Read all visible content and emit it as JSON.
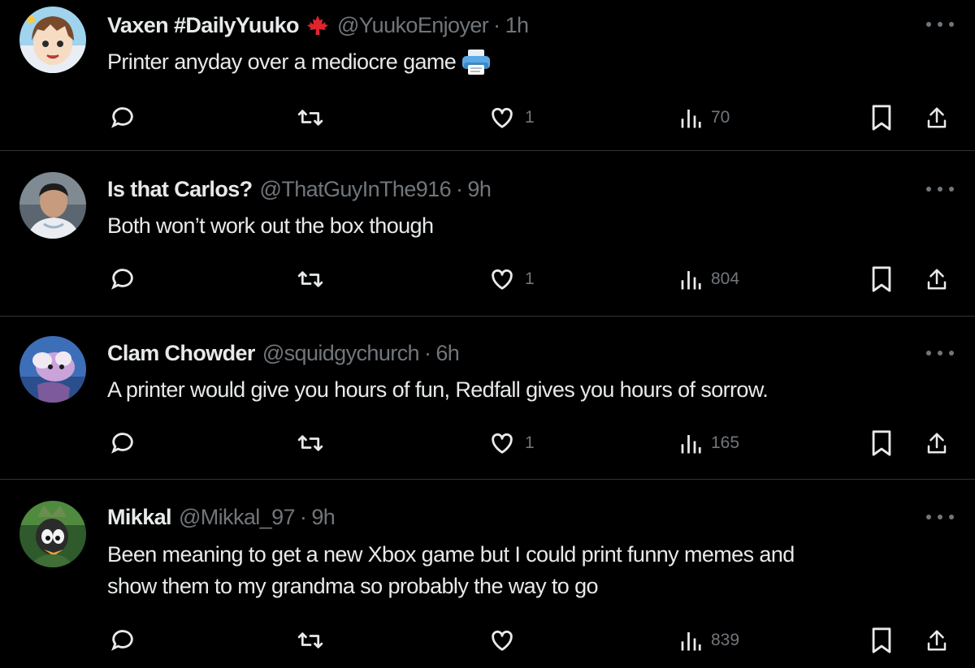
{
  "colors": {
    "background": "#000000",
    "primary_text": "#e7e9ea",
    "secondary_text": "#71767b",
    "divider": "#2f3336"
  },
  "tweets": [
    {
      "display_name": "Vaxen #DailyYuuko",
      "badge_icon": "canada-maple-leaf-icon",
      "handle": "@YuukoEnjoyer",
      "separator": "·",
      "time": "1h",
      "text": "Printer anyday over a mediocre game",
      "text_emoji": "printer-emoji",
      "likes": "1",
      "views": "70"
    },
    {
      "display_name": "Is that Carlos?",
      "handle": "@ThatGuyInThe916",
      "separator": "·",
      "time": "9h",
      "text": "Both won’t work out the box though",
      "likes": "1",
      "views": "804"
    },
    {
      "display_name": "Clam Chowder",
      "handle": "@squidgychurch",
      "separator": "·",
      "time": "6h",
      "text": "A printer would give you hours of fun, Redfall gives you hours of sorrow.",
      "likes": "1",
      "views": "165"
    },
    {
      "display_name": "Mikkal",
      "handle": "@Mikkal_97",
      "separator": "·",
      "time": "9h",
      "text_lines": [
        "Been meaning to get a new Xbox game but I could print funny memes and",
        "show them to my grandma so probably the way to go"
      ],
      "likes": "",
      "views": "839"
    }
  ]
}
